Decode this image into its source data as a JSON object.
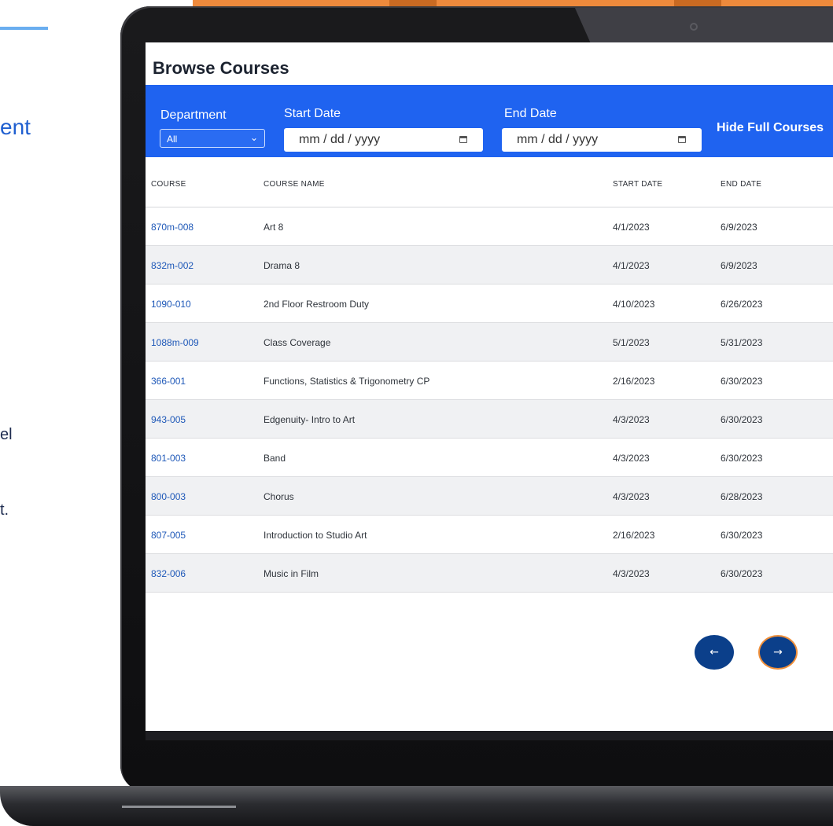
{
  "side_fragments": {
    "heading": "ent",
    "line_1": "el",
    "line_2": "t."
  },
  "page": {
    "title": "Browse Courses"
  },
  "filters": {
    "department_label": "Department",
    "department_value": "All",
    "start_date_label": "Start Date",
    "start_date_placeholder": "mm / dd / yyyy",
    "end_date_label": "End Date",
    "end_date_placeholder": "mm / dd / yyyy",
    "hide_full_label": "Hide Full Courses"
  },
  "table": {
    "headers": [
      "COURSE",
      "COURSE NAME",
      "START DATE",
      "END DATE"
    ],
    "rows": [
      {
        "course": "870m-008",
        "name": "Art 8",
        "start": "4/1/2023",
        "end": "6/9/2023"
      },
      {
        "course": "832m-002",
        "name": "Drama 8",
        "start": "4/1/2023",
        "end": "6/9/2023"
      },
      {
        "course": "1090-010",
        "name": "2nd Floor Restroom Duty",
        "start": "4/10/2023",
        "end": "6/26/2023"
      },
      {
        "course": "1088m-009",
        "name": "Class Coverage",
        "start": "5/1/2023",
        "end": "5/31/2023"
      },
      {
        "course": "366-001",
        "name": "Functions, Statistics & Trigonometry CP",
        "start": "2/16/2023",
        "end": "6/30/2023"
      },
      {
        "course": "943-005",
        "name": "Edgenuity- Intro to Art",
        "start": "4/3/2023",
        "end": "6/30/2023"
      },
      {
        "course": "801-003",
        "name": "Band",
        "start": "4/3/2023",
        "end": "6/30/2023"
      },
      {
        "course": "800-003",
        "name": "Chorus",
        "start": "4/3/2023",
        "end": "6/28/2023"
      },
      {
        "course": "807-005",
        "name": "Introduction to Studio Art",
        "start": "2/16/2023",
        "end": "6/30/2023"
      },
      {
        "course": "832-006",
        "name": "Music in Film",
        "start": "4/3/2023",
        "end": "6/30/2023"
      }
    ]
  },
  "pagination": {
    "prev_icon": "arrow-left-icon",
    "prev_glyph": "←",
    "next_icon": "arrow-right-icon",
    "next_glyph": "→"
  },
  "colors": {
    "filter_bar": "#1f63f0",
    "course_link": "#1e58b8",
    "pagination_button": "#0b3f8a",
    "next_button_ring": "#ef8f3a",
    "brand_orange": "#ee8a3c"
  }
}
